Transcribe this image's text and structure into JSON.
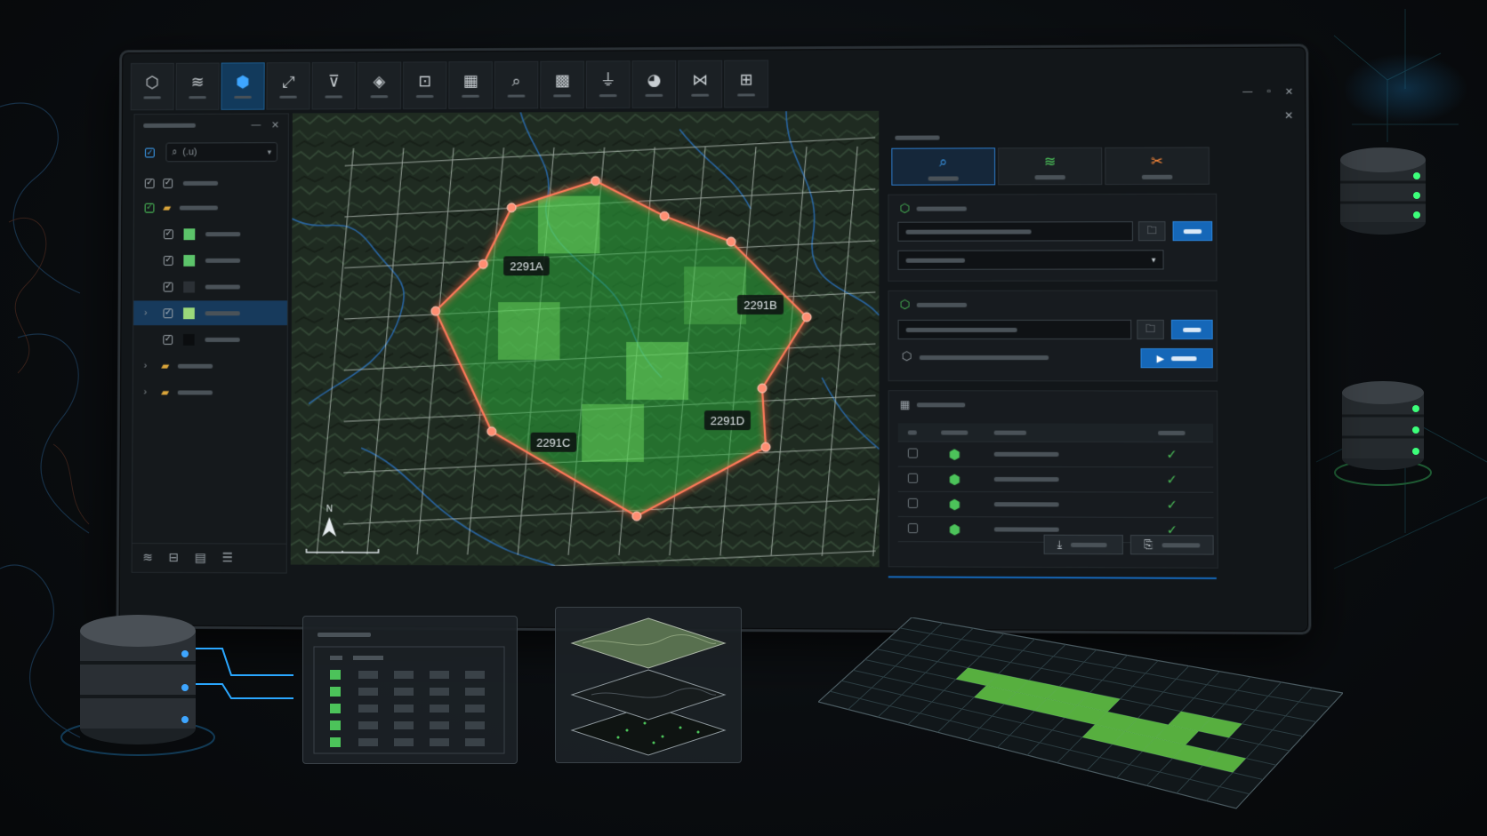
{
  "window": {
    "minimize_icon": "minimize-icon",
    "maximize_icon": "maximize-icon",
    "close_icon": "close-icon"
  },
  "toolbar": {
    "tools": [
      {
        "icon": "cube-icon",
        "glyph": "⬡",
        "active": false
      },
      {
        "icon": "layers-icon",
        "glyph": "≋",
        "active": false
      },
      {
        "icon": "3d-block-icon",
        "glyph": "⬢",
        "active": true
      },
      {
        "icon": "expand-icon",
        "glyph": "⤢",
        "active": false
      },
      {
        "icon": "filter-icon",
        "glyph": "⊽",
        "active": false
      },
      {
        "icon": "box-icon",
        "glyph": "◈",
        "active": false
      },
      {
        "icon": "scan-icon",
        "glyph": "⊡",
        "active": false
      },
      {
        "icon": "grid-table-icon",
        "glyph": "▦",
        "active": false
      },
      {
        "icon": "zoom-map-icon",
        "glyph": "⌕",
        "active": false
      },
      {
        "icon": "grid-icon",
        "glyph": "▩",
        "active": false
      },
      {
        "icon": "funnel-icon",
        "glyph": "⏚",
        "active": false
      },
      {
        "icon": "pie-icon",
        "glyph": "◕",
        "active": false
      },
      {
        "icon": "network-icon",
        "glyph": "⋈",
        "active": false
      },
      {
        "icon": "frame-icon",
        "glyph": "⊞",
        "active": false
      }
    ]
  },
  "layers_panel": {
    "search_placeholder": "⌕  (.u)",
    "rows": [
      {
        "type": "layer",
        "checked": true,
        "swatch": "#9aa2a8",
        "swatch_kind": "check",
        "selected": false
      },
      {
        "type": "folder",
        "checked": true,
        "selected": false
      },
      {
        "type": "layer",
        "checked": true,
        "swatch": "#5cc46a",
        "selected": false
      },
      {
        "type": "layer",
        "checked": true,
        "swatch": "#5cc46a",
        "selected": false
      },
      {
        "type": "layer",
        "checked": true,
        "swatch": "#2b3035",
        "selected": false
      },
      {
        "type": "layer",
        "checked": true,
        "swatch": "#9bd87a",
        "selected": true
      },
      {
        "type": "layer",
        "checked": true,
        "swatch": "#0b0d0f",
        "selected": false
      },
      {
        "type": "folder",
        "checked": false,
        "selected": false
      },
      {
        "type": "folder",
        "checked": false,
        "selected": false
      }
    ],
    "footer_icons": [
      "layers-icon",
      "folder-icon",
      "table-icon",
      "stack-icon"
    ]
  },
  "map": {
    "plot_labels": [
      "2291A",
      "2291B",
      "2291C",
      "2291D"
    ],
    "north_label": "N",
    "accent": "#ff6a4a",
    "fill": "#3fcf4a"
  },
  "tool_panel": {
    "tabs": [
      {
        "icon": "search-icon",
        "glyph": "⌕",
        "color": "#3ea6ff"
      },
      {
        "icon": "layers-icon",
        "glyph": "≋",
        "color": "#4cc35a"
      },
      {
        "icon": "tools-icon",
        "glyph": "✂",
        "color": "#ff8a3a"
      }
    ],
    "results_rows": 4
  }
}
